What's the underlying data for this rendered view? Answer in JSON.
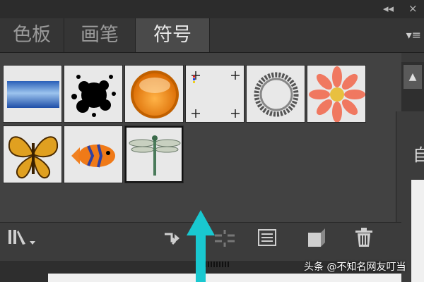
{
  "titlebar": {
    "collapse_glyph": "◂◂",
    "close_glyph": "×"
  },
  "tabs": [
    {
      "label": "色板",
      "active": false
    },
    {
      "label": "画笔",
      "active": false
    },
    {
      "label": "符号",
      "active": true
    }
  ],
  "menu_icon": "▾≡",
  "symbols": [
    {
      "icon": "blue-gradient-bar-symbol-icon"
    },
    {
      "icon": "ink-splatter-symbol-icon"
    },
    {
      "icon": "orange-button-symbol-icon"
    },
    {
      "icon": "crop-marks-symbol-icon"
    },
    {
      "icon": "ribbon-ring-symbol-icon"
    },
    {
      "icon": "pink-flower-symbol-icon"
    },
    {
      "icon": "butterfly-symbol-icon"
    },
    {
      "icon": "fish-symbol-icon"
    },
    {
      "icon": "dragonfly-symbol-icon",
      "selected": true
    }
  ],
  "toolbar_icons": [
    "symbol-library-icon",
    "place-symbol-instance-icon",
    "break-link-icon",
    "symbol-options-icon",
    "new-symbol-icon",
    "delete-symbol-icon"
  ],
  "side_panel": {
    "text": "自"
  },
  "watermark": "头条 @不知名网友叮当",
  "colors": {
    "accent_arrow": "#19c8d0",
    "panel_bg": "#424242",
    "tab_active": "#4a4a4a"
  }
}
